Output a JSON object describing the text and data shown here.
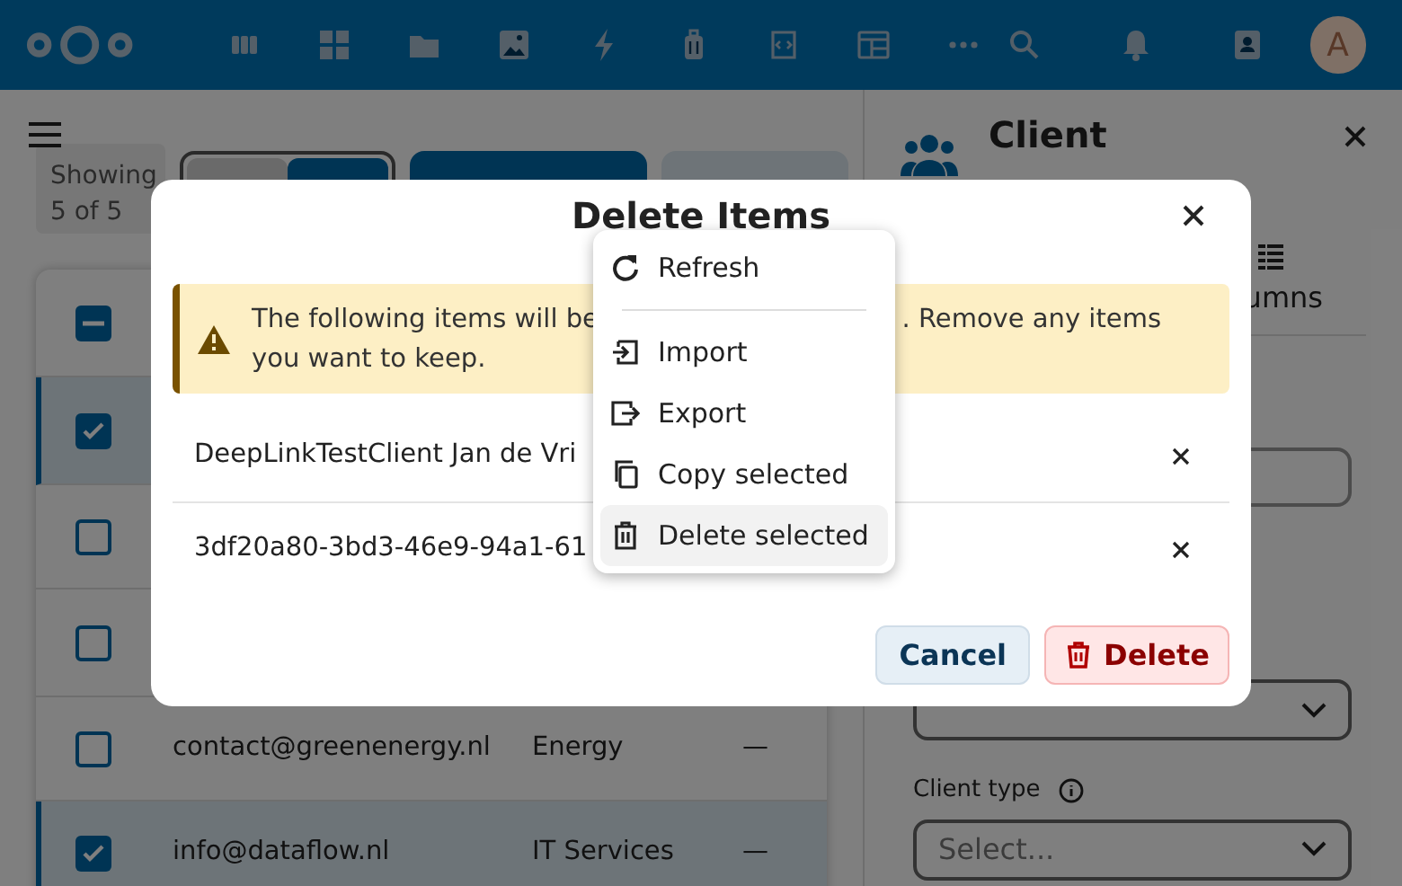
{
  "header": {
    "avatar": "A"
  },
  "toolbar": {
    "showing_label": "Showing",
    "count": "5 of 5",
    "view_toggle": [
      {
        "selected": false
      },
      {
        "selected": true
      }
    ]
  },
  "table": {
    "header_checkbox": {
      "indeterminate": true
    },
    "rows": [
      {
        "checked": true
      },
      {
        "checked": false
      },
      {
        "checked": false
      },
      {
        "checked": false,
        "cells": [
          "contact@greenenergy.nl",
          "Energy",
          "—"
        ]
      },
      {
        "checked": true,
        "cells": [
          "info@dataflow.nl",
          "IT Services",
          "—"
        ]
      }
    ]
  },
  "side_panel": {
    "title": "Client",
    "tab_label": "umns",
    "fields": [
      {
        "kind": "input"
      },
      {
        "kind": "select"
      },
      {
        "kind": "select",
        "label": "Client type",
        "placeholder": "Select..."
      }
    ]
  },
  "dialog": {
    "title": "Delete Items",
    "warning": {
      "line_1_start": "The following items will be",
      "line_1_end": ". Remove any items",
      "line_2": "you want to keep."
    },
    "items": [
      "DeepLinkTestClient Jan de Vri",
      "3df20a80-3bd3-46e9-94a1-61"
    ],
    "cancel": "Cancel",
    "delete": "Delete"
  },
  "menu": {
    "items": [
      {
        "kind": "action",
        "label": "Refresh",
        "selected": false
      },
      {
        "kind": "divider"
      },
      {
        "kind": "action",
        "label": "Import",
        "selected": false
      },
      {
        "kind": "action",
        "label": "Export",
        "selected": false
      },
      {
        "kind": "action",
        "label": "Copy selected",
        "selected": false
      },
      {
        "kind": "action",
        "label": "Delete selected",
        "selected": true
      }
    ]
  }
}
